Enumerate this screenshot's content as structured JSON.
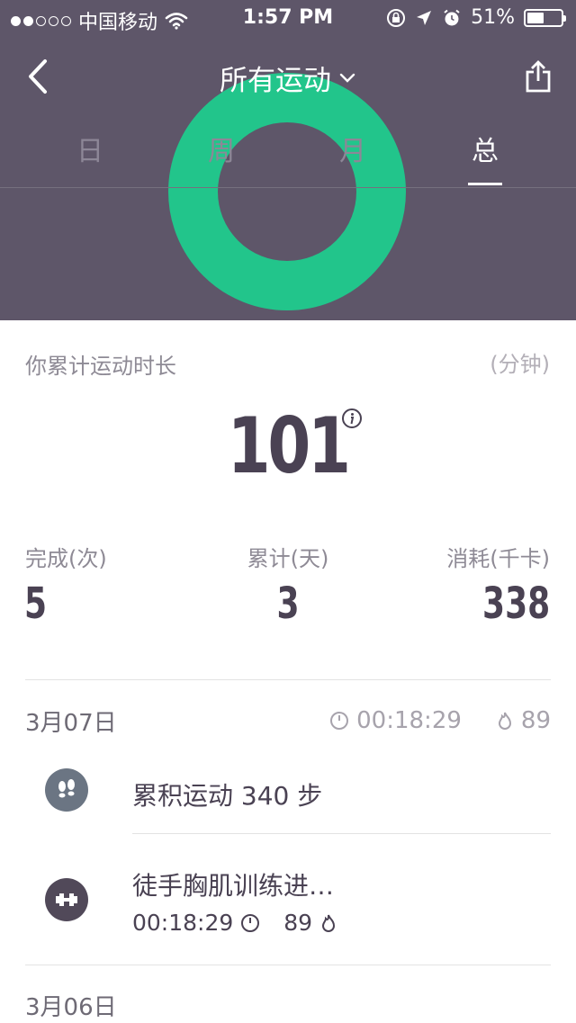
{
  "status_bar": {
    "carrier": "中国移动",
    "time": "1:57 PM",
    "battery": "51%",
    "battery_level": 0.51
  },
  "nav": {
    "title": "所有运动"
  },
  "tabs": [
    {
      "label": "日",
      "active": false
    },
    {
      "label": "周",
      "active": false
    },
    {
      "label": "月",
      "active": false
    },
    {
      "label": "总",
      "active": true
    }
  ],
  "colors": {
    "header_bg": "#5e5669",
    "ring": "#22c58b",
    "text_dark": "#4a4253",
    "text_grey": "#8e8a95"
  },
  "summary": {
    "duration_label": "你累计运动时长",
    "unit": "(分钟)",
    "duration_value": "101",
    "stats": [
      {
        "label": "完成(次)",
        "value": "5"
      },
      {
        "label": "累计(天)",
        "value": "3"
      },
      {
        "label": "消耗(千卡)",
        "value": "338"
      }
    ]
  },
  "records": [
    {
      "date": "3月07日",
      "duration": "00:18:29",
      "calories": "89",
      "items": [
        {
          "icon": "footprints-icon",
          "text": "累积运动 340 步"
        },
        {
          "icon": "dumbbell-icon",
          "text": "徒手胸肌训练进…",
          "duration": "00:18:29",
          "calories": "89"
        }
      ]
    },
    {
      "date": "3月06日"
    }
  ]
}
